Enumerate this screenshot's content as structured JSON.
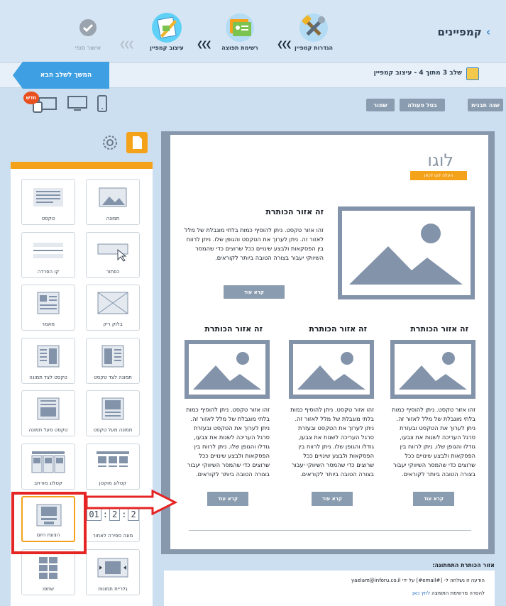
{
  "header": {
    "title": "קמפיינים",
    "steps": [
      {
        "label": "הגדרות קמפיין",
        "icon": "tools-icon"
      },
      {
        "label": "רשימת תפוצה",
        "icon": "contacts-icon"
      },
      {
        "label": "עיצוב קמפיין",
        "icon": "design-icon"
      },
      {
        "label": "אישור סופי",
        "icon": "check-icon"
      }
    ]
  },
  "stepbar": {
    "info": "שלב 3 מתוך 4 - עיצוב קמפיין",
    "next": "המשך לשלב הבא"
  },
  "toolbar": {
    "change_template": "שנה תבנית",
    "cancel_action": "בטל פעולה",
    "save": "שמור",
    "new_badge": "חדש"
  },
  "sidebar": {
    "blocks": [
      "תמונה",
      "טקסט",
      "כפתור",
      "קו הפרדה",
      "בלוק ריק",
      "מאמר",
      "תמונה לצד טקסט",
      "טקסט לצד תמונה",
      "תמונה מעל טקסט",
      "טקסט מעל תמונה",
      "קטלוג מוקטן",
      "קטלוג מורחב",
      "מונה ספירה לאחור",
      "הצעת היום",
      "גלריית תמונות",
      "שתפו"
    ],
    "countdown": [
      "01",
      "2",
      "2"
    ]
  },
  "canvas": {
    "logo": "לוגו",
    "upload_logo": "העלה לוגו לכאן",
    "main_heading": "זה אזור הכותרת",
    "main_text": "זהו אזור טקסט. ניתן להוסיף כמות בלתי מוגבלת של מלל לאזור זה. ניתן לערוך את הטקסט והגופן שלו. ניתן לרווח בין הפסקאות ולבצע שינויים ככל שרוצים כדי שהמסר השיווקי יעבור בצורה הטובה ביותר לקוראים.",
    "read_more": "קרא עוד",
    "columns": [
      {
        "heading": "זה אזור הכותרת",
        "text": "זהו אזור טקסט. ניתן להוסיף כמות בלתי מוגבלת של מלל לאזור זה. ניתן לערוך את הטקסט ובעזרת סרגל העריכה לשנות את צבעו, גודלו והגופן שלו. ניתן לרווח בין הפסקאות ולבצע שינויים ככל שרוצים כדי שהמסר השיווקי יעבור בצורה הטובה ביותר לקוראים.",
        "button": "קרא עוד"
      },
      {
        "heading": "זה אזור הכותרת",
        "text": "זהו אזור טקסט. ניתן להוסיף כמות בלתי מוגבלת של מלל לאזור זה. ניתן לערוך את הטקסט ובעזרת סרגל העריכה לשנות את צבעו, גודלו והגופן שלו. ניתן לרווח בין הפסקאות ולבצע שינויים ככל שרוצים כדי שהמסר השיווקי יעבור בצורה הטובה ביותר לקוראים.",
        "button": "קרא עוד"
      },
      {
        "heading": "זה אזור הכותרת",
        "text": "זהו אזור טקסט. ניתן להוסיף כמות בלתי מוגבלת של מלל לאזור זה. ניתן לערוך את הטקסט ובעזרת סרגל העריכה לשנות את צבעו, גודלו והגופן שלו. ניתן לרווח בין הפסקאות ולבצע שינויים ככל שרוצים כדי שהמסר השיווקי יעבור בצורה הטובה ביותר לקוראים.",
        "button": "קרא עוד"
      }
    ]
  },
  "footer": {
    "title": "אזור הכותרת התחתונה:",
    "line1": "הודעה זו נשלחה ל- [#email#] על ידי yaelam@inforu.co.il",
    "line2_prefix": "להסרה מרשימת התפוצה",
    "line2_link": "לחץ כאן"
  },
  "colors": {
    "accent": "#f5a21b",
    "primary": "#3ea0e2",
    "highlight": "#e52424"
  }
}
